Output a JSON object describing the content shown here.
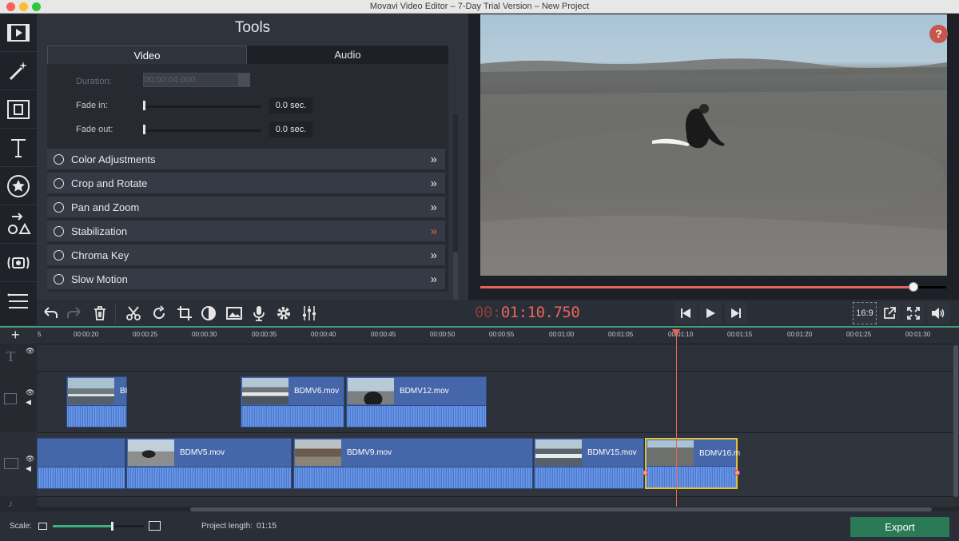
{
  "window": {
    "title": "Movavi Video Editor – 7-Day Trial Version – New Project"
  },
  "sidebar": {
    "items": [
      {
        "name": "import-icon"
      },
      {
        "name": "filters-icon"
      },
      {
        "name": "transitions-icon"
      },
      {
        "name": "titles-icon"
      },
      {
        "name": "stickers-icon"
      },
      {
        "name": "callouts-icon"
      },
      {
        "name": "record-icon"
      },
      {
        "name": "more-tools-icon"
      }
    ]
  },
  "tools": {
    "title": "Tools",
    "tabs": {
      "video": "Video",
      "audio": "Audio"
    },
    "duration": {
      "label": "Duration:",
      "value": "00:00:04.000"
    },
    "fade_in": {
      "label": "Fade in:",
      "value": "0.0 sec.",
      "level": 0
    },
    "fade_out": {
      "label": "Fade out:",
      "value": "0.0 sec.",
      "level": 0
    },
    "sections": [
      {
        "label": "Color Adjustments",
        "active": false
      },
      {
        "label": "Crop and Rotate",
        "active": false
      },
      {
        "label": "Pan and Zoom",
        "active": false
      },
      {
        "label": "Stabilization",
        "active": true
      },
      {
        "label": "Chroma Key",
        "active": false
      },
      {
        "label": "Slow Motion",
        "active": false
      }
    ]
  },
  "preview": {
    "help": "?",
    "progress": 0.93,
    "accent": "#e0655a"
  },
  "transport": {
    "timecode_dim": "00:",
    "timecode": "01:10.750",
    "aspect": "16:9"
  },
  "ruler": {
    "ticks": [
      "5",
      "00:00:20",
      "00:00:25",
      "00:00:30",
      "00:00:35",
      "00:00:40",
      "00:00:45",
      "00:00:50",
      "00:00:55",
      "00:01:00",
      "00:01:05",
      "00:01:10",
      "00:01:15",
      "00:01:20",
      "00:01:25",
      "00:01:30"
    ]
  },
  "clips": {
    "overlay": [
      {
        "name": "BI"
      },
      {
        "name": "BDMV6.mov"
      },
      {
        "name": "BDMV12.mov"
      }
    ],
    "main": [
      {
        "name": ""
      },
      {
        "name": "BDMV5.mov"
      },
      {
        "name": "BDMV9.mov"
      },
      {
        "name": "BDMV15.mov"
      },
      {
        "name": "BDMV16.m"
      }
    ]
  },
  "bottom": {
    "scale_label": "Scale:",
    "scale_level": 0.65,
    "project_length_label": "Project length:",
    "project_length": "01:15",
    "export": "Export"
  }
}
